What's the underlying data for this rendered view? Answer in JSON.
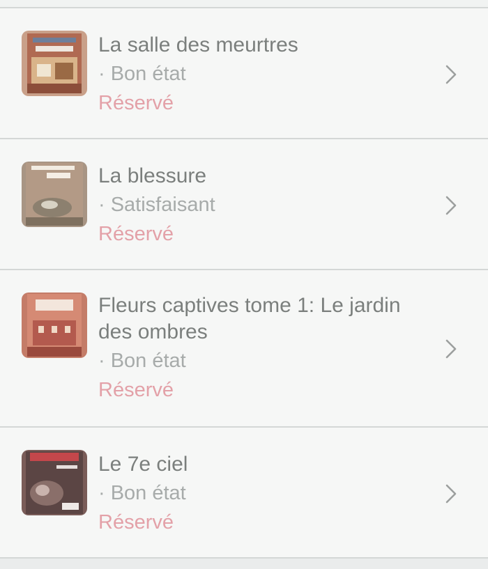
{
  "items": [
    {
      "title": "La salle des meurtres",
      "condition": "· Bon état",
      "status": "Réservé",
      "cover": "book-cover-la-salle-des-meurtres",
      "status_color": "#e3a1a8"
    },
    {
      "title": "La blessure",
      "condition": "· Satisfaisant",
      "status": "Réservé",
      "cover": "book-cover-la-blessure",
      "status_color": "#e3a1a8"
    },
    {
      "title": "Fleurs captives tome 1: Le jardin des ombres",
      "condition": "· Bon état",
      "status": "Réservé",
      "cover": "book-cover-fleurs-captives",
      "status_color": "#e3a1a8"
    },
    {
      "title": "Le 7e ciel",
      "condition": "· Bon état",
      "status": "Réservé",
      "cover": "book-cover-le-7e-ciel",
      "status_color": "#e3a1a8"
    }
  ],
  "icons": {
    "row_action": "chevron-right-icon"
  }
}
